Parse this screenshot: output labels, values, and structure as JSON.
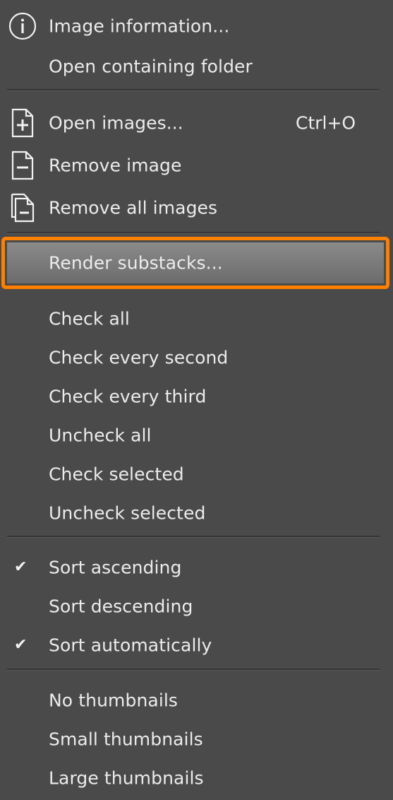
{
  "menu": {
    "items": [
      {
        "label": "Image information...",
        "icon": "info-icon"
      },
      {
        "label": "Open containing folder"
      },
      {
        "label": "Open images...",
        "shortcut": "Ctrl+O",
        "icon": "add-file-icon"
      },
      {
        "label": "Remove image",
        "icon": "remove-file-icon"
      },
      {
        "label": "Remove all images",
        "icon": "remove-all-files-icon"
      },
      {
        "label": "Render substacks...",
        "highlighted": true
      },
      {
        "label": "Check all"
      },
      {
        "label": "Check every second"
      },
      {
        "label": "Check every third"
      },
      {
        "label": "Uncheck all"
      },
      {
        "label": "Check selected"
      },
      {
        "label": "Uncheck selected"
      },
      {
        "label": "Sort ascending",
        "checked": true
      },
      {
        "label": "Sort descending",
        "checked": false
      },
      {
        "label": "Sort automatically",
        "checked": true
      },
      {
        "label": "No thumbnails"
      },
      {
        "label": "Small thumbnails"
      },
      {
        "label": "Large thumbnails"
      }
    ]
  },
  "colors": {
    "background": "#4a4a4a",
    "text": "#ececec",
    "highlight_border": "#ff7f00",
    "separator": "#353535"
  }
}
